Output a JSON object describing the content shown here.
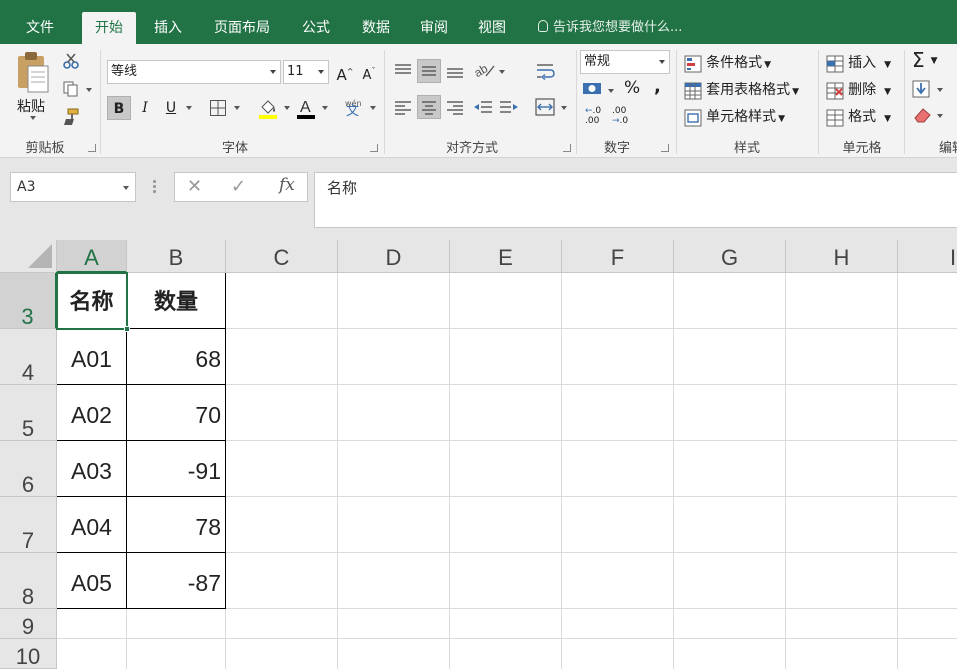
{
  "tabs": [
    {
      "label": "文件",
      "active": false
    },
    {
      "label": "开始",
      "active": true
    },
    {
      "label": "插入",
      "active": false
    },
    {
      "label": "页面布局",
      "active": false
    },
    {
      "label": "公式",
      "active": false
    },
    {
      "label": "数据",
      "active": false
    },
    {
      "label": "审阅",
      "active": false
    },
    {
      "label": "视图",
      "active": false
    }
  ],
  "tell_me": "告诉我您想要做什么...",
  "ribbon": {
    "clipboard": {
      "paste_label": "粘贴",
      "group_label": "剪贴板"
    },
    "font": {
      "font_name": "等线",
      "font_size": "11",
      "group_label": "字体",
      "phonetic_glyph": "wén",
      "phonetic_char": "文"
    },
    "alignment": {
      "group_label": "对齐方式"
    },
    "number": {
      "format": "常规",
      "percent": "%",
      "comma": ",",
      "group_label": "数字",
      "inc_decimal": ".00",
      "dec_decimal": ".0"
    },
    "styles": {
      "conditional": "条件格式",
      "table_format": "套用表格格式",
      "cell_styles": "单元格样式",
      "group_label": "样式"
    },
    "cells": {
      "insert": "插入",
      "delete": "删除",
      "format": "格式",
      "group_label": "单元格"
    },
    "editing": {
      "group_label": "编辑",
      "sum_glyph": "Σ"
    }
  },
  "formula_bar": {
    "name_box": "A3",
    "cancel_glyph": "✕",
    "enter_glyph": "✓",
    "fx_glyph": "fx",
    "value": "名称"
  },
  "grid": {
    "columns": [
      "A",
      "B",
      "C",
      "D",
      "E",
      "F",
      "G",
      "H",
      "I"
    ],
    "rows": [
      "3",
      "4",
      "5",
      "6",
      "7",
      "8",
      "9",
      "10"
    ],
    "selected_cell": "A3",
    "header": [
      "名称",
      "数量"
    ],
    "data": [
      [
        "A01",
        "68"
      ],
      [
        "A02",
        "70"
      ],
      [
        "A03",
        "-91"
      ],
      [
        "A04",
        "78"
      ],
      [
        "A05",
        "-87"
      ]
    ]
  },
  "colors": {
    "accent": "#217346",
    "ribbon_bg": "#f3f3f3",
    "header_bg": "#e6e6e6"
  }
}
